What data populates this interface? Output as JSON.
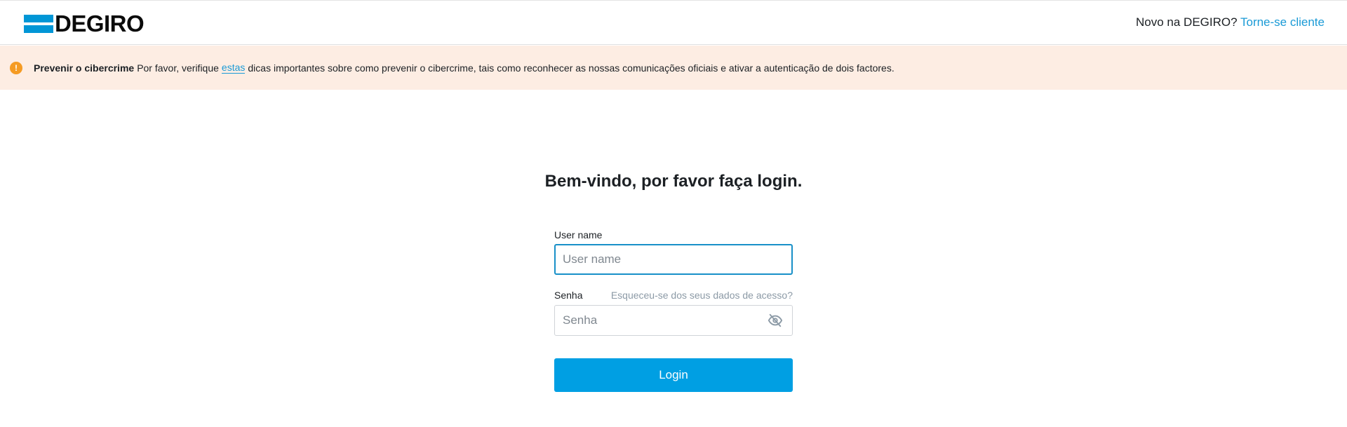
{
  "brand": {
    "name": "DEGIRO",
    "accent_color": "#0096d6"
  },
  "header": {
    "prompt_text": "Novo na DEGIRO?",
    "signup_link": "Torne-se cliente"
  },
  "notice": {
    "icon": "exclamation-icon",
    "title": "Prevenir o cibercrime",
    "text_before": "Por favor, verifique",
    "link_text": "estas",
    "text_after": "dicas importantes sobre como prevenir o cibercrime, tais como reconhecer as nossas comunicações oficiais e ativar a autenticação de dois factores.",
    "background_color": "#fdede3",
    "icon_color": "#f59b23"
  },
  "login": {
    "welcome": "Bem-vindo, por favor faça login.",
    "username": {
      "label": "User name",
      "placeholder": "User name",
      "value": ""
    },
    "password": {
      "label": "Senha",
      "placeholder": "Senha",
      "value": "",
      "forgot_link": "Esqueceu-se dos seus dados de acesso?",
      "toggle_icon": "eye-slash-icon"
    },
    "submit_label": "Login",
    "button_color": "#009fe3"
  }
}
